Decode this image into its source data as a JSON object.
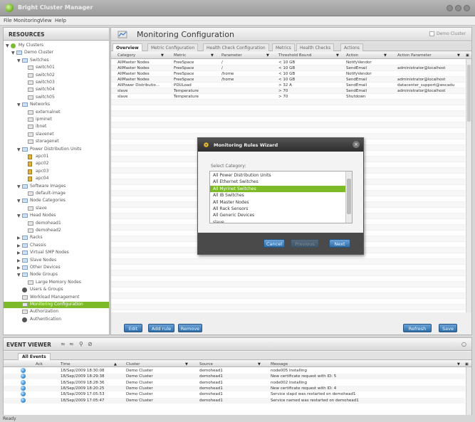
{
  "window": {
    "title": "Bright Cluster Manager"
  },
  "menu": [
    "File",
    "Monitoring",
    "View",
    "Help"
  ],
  "resources": {
    "header": "RESOURCES",
    "tree": [
      {
        "label": "My Clusters",
        "indent": 0,
        "icon": "globe",
        "toggle": "▼"
      },
      {
        "label": "Demo Cluster",
        "indent": 1,
        "icon": "folder",
        "toggle": "▼"
      },
      {
        "label": "Switches",
        "indent": 2,
        "icon": "folder",
        "toggle": "▼"
      },
      {
        "label": "switch01",
        "indent": 3,
        "icon": "node"
      },
      {
        "label": "switch02",
        "indent": 3,
        "icon": "node"
      },
      {
        "label": "switch03",
        "indent": 3,
        "icon": "node"
      },
      {
        "label": "switch04",
        "indent": 3,
        "icon": "node"
      },
      {
        "label": "switch05",
        "indent": 3,
        "icon": "node"
      },
      {
        "label": "Networks",
        "indent": 2,
        "icon": "folder",
        "toggle": "▼"
      },
      {
        "label": "externalnet",
        "indent": 3,
        "icon": "node"
      },
      {
        "label": "ipminet",
        "indent": 3,
        "icon": "node"
      },
      {
        "label": "ibnet",
        "indent": 3,
        "icon": "node"
      },
      {
        "label": "slavenet",
        "indent": 3,
        "icon": "node"
      },
      {
        "label": "storagenet",
        "indent": 3,
        "icon": "node"
      },
      {
        "label": "Power Distribution Units",
        "indent": 2,
        "icon": "folder",
        "toggle": "▼"
      },
      {
        "label": "apc01",
        "indent": 3,
        "icon": "power"
      },
      {
        "label": "apc02",
        "indent": 3,
        "icon": "power"
      },
      {
        "label": "apc03",
        "indent": 3,
        "icon": "power"
      },
      {
        "label": "apc04",
        "indent": 3,
        "icon": "power"
      },
      {
        "label": "Software Images",
        "indent": 2,
        "icon": "folder",
        "toggle": "▼"
      },
      {
        "label": "default-image",
        "indent": 3,
        "icon": "node"
      },
      {
        "label": "Node Categories",
        "indent": 2,
        "icon": "folder",
        "toggle": "▼"
      },
      {
        "label": "slave",
        "indent": 3,
        "icon": "node"
      },
      {
        "label": "Head Nodes",
        "indent": 2,
        "icon": "folder",
        "toggle": "▼"
      },
      {
        "label": "demohead1",
        "indent": 3,
        "icon": "node"
      },
      {
        "label": "demohead2",
        "indent": 3,
        "icon": "node"
      },
      {
        "label": "Racks",
        "indent": 2,
        "icon": "folder",
        "toggle": "▶"
      },
      {
        "label": "Chassis",
        "indent": 2,
        "icon": "folder",
        "toggle": "▶"
      },
      {
        "label": "Virtual SMP Nodes",
        "indent": 2,
        "icon": "folder",
        "toggle": "▶"
      },
      {
        "label": "Slave Nodes",
        "indent": 2,
        "icon": "folder",
        "toggle": "▶"
      },
      {
        "label": "Other Devices",
        "indent": 2,
        "icon": "folder",
        "toggle": "▶"
      },
      {
        "label": "Node Groups",
        "indent": 2,
        "icon": "folder",
        "toggle": "▼"
      },
      {
        "label": "Large Memory Nodes",
        "indent": 3,
        "icon": "node"
      },
      {
        "label": "Users & Groups",
        "indent": 2,
        "icon": "user"
      },
      {
        "label": "Workload Management",
        "indent": 2,
        "icon": "node"
      },
      {
        "label": "Monitoring Configuration",
        "indent": 2,
        "icon": "node",
        "selected": true
      },
      {
        "label": "Authorization",
        "indent": 2,
        "icon": "node"
      },
      {
        "label": "Authentication",
        "indent": 2,
        "icon": "user"
      }
    ]
  },
  "main": {
    "title": "Monitoring Configuration",
    "demo_cluster_label": "Demo Cluster",
    "tabs": [
      {
        "label": "Overview",
        "active": true
      },
      {
        "label": "Metric Configuration"
      },
      {
        "label": "Health Check Configuration"
      },
      {
        "label": "Metrics"
      },
      {
        "label": "Health Checks"
      },
      {
        "label": "Actions"
      }
    ],
    "columns": [
      "Category",
      "Metric",
      "Parameter",
      "Threshold Bound",
      "Action",
      "Action Parameter"
    ],
    "rows": [
      [
        "AllMaster Nodes",
        "FreeSpace",
        "/",
        "< 10 GB",
        "NotifyVendor",
        ""
      ],
      [
        "AllMaster Nodes",
        "FreeSpace",
        "/",
        "< 10 GB",
        "SendEmail",
        "administrator@localhost"
      ],
      [
        "AllMaster Nodes",
        "FreeSpace",
        "/home",
        "< 10 GB",
        "NotifyVendor",
        ""
      ],
      [
        "AllMaster Nodes",
        "FreeSpace",
        "/home",
        "< 10 GB",
        "SendEmail",
        "administrator@localhost"
      ],
      [
        "AllPower Distributio...",
        "PDULoad",
        "",
        "> 32 A",
        "SendEmail",
        "datacenter_support@wscadu"
      ],
      [
        "slave",
        "Temperature",
        "",
        "> 70",
        "SendEmail",
        "administrator@localhost"
      ],
      [
        "slave",
        "Temperature",
        "",
        "> 70",
        "Shutdown",
        ""
      ]
    ],
    "buttons": {
      "edit": "Edit",
      "add_rule": "Add rule",
      "remove": "Remove",
      "refresh": "Refresh",
      "save": "Save"
    }
  },
  "wizard": {
    "title": "Monitoring Rules Wizard",
    "close_glyph": "×",
    "select_label": "Select Category:",
    "categories": [
      "All Power Distribution Units",
      "All Ethernet Switches",
      "All Myrinet Switches",
      "All IB Switches",
      "All Master Nodes",
      "All Rack Sensors",
      "All Generic Devices",
      "slave"
    ],
    "selected_index": 2,
    "buttons": {
      "cancel": "Cancel",
      "previous": "Previous",
      "next": "Next"
    }
  },
  "events": {
    "header": "EVENT VIEWER",
    "tab": "All Events",
    "columns": [
      "Ack",
      "Time",
      "Cluster",
      "Source",
      "Message"
    ],
    "rows": [
      [
        "18/Sep/2009 18:30:08",
        "Demo Cluster",
        "demohead1",
        "node005 Installing"
      ],
      [
        "18/Sep/2009 18:29:38",
        "Demo Cluster",
        "demohead1",
        "New certificate request with ID: 5"
      ],
      [
        "18/Sep/2009 18:28:36",
        "Demo Cluster",
        "demohead1",
        "node002 Installing"
      ],
      [
        "18/Sep/2009 18:20:25",
        "Demo Cluster",
        "demohead1",
        "New certificate request with ID: 4"
      ],
      [
        "18/Sep/2009 17:05:53",
        "Demo Cluster",
        "demohead1",
        "Service slapd was restarted on demohead1"
      ],
      [
        "18/Sep/2009 17:05:47",
        "Demo Cluster",
        "demohead1",
        "Service named was restarted on demohead1"
      ]
    ]
  },
  "status": {
    "text": "Ready"
  }
}
